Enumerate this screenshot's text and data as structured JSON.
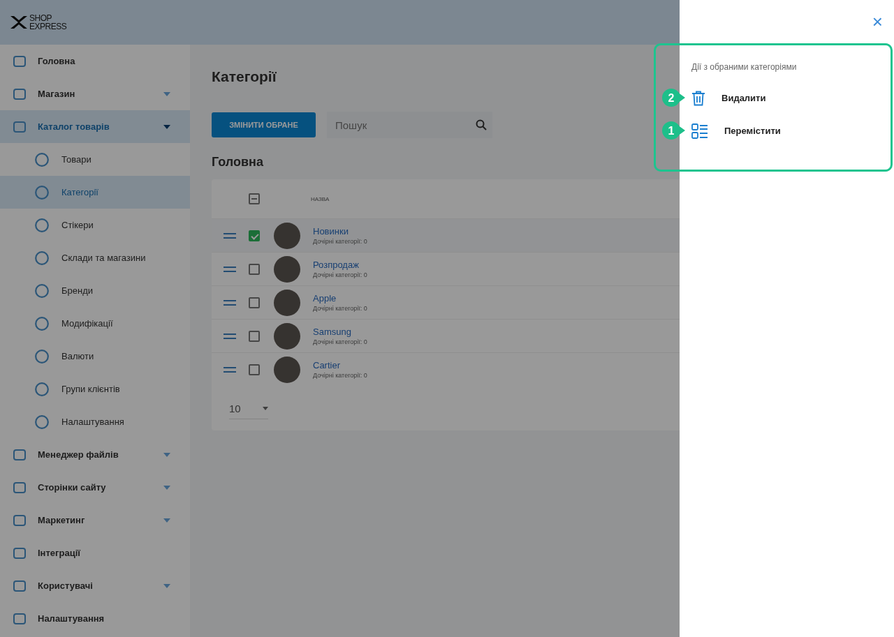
{
  "logo": {
    "line_1": "SHOP",
    "line_2": "EXPRESS"
  },
  "sidebar": {
    "items": [
      {
        "label": "Головна",
        "selected": false
      },
      {
        "label": "Магазин",
        "selected": false,
        "expanded": false
      },
      {
        "label": "Каталог товарів",
        "selected": true,
        "expanded": true,
        "children": [
          {
            "label": "Товари",
            "selected": false
          },
          {
            "label": "Категорії",
            "selected": true
          },
          {
            "label": "Стікери",
            "selected": false
          },
          {
            "label": "Склади та магазини",
            "selected": false
          },
          {
            "label": "Бренди",
            "selected": false
          },
          {
            "label": "Модифікації",
            "selected": false
          },
          {
            "label": "Валюти",
            "selected": false
          },
          {
            "label": "Групи клієнтів",
            "selected": false
          },
          {
            "label": "Налаштування",
            "selected": false
          }
        ]
      },
      {
        "label": "Менеджер файлів",
        "selected": false,
        "expanded": false
      },
      {
        "label": "Сторінки сайту",
        "selected": false,
        "expanded": false
      },
      {
        "label": "Маркетинг",
        "selected": false,
        "expanded": false
      },
      {
        "label": "Інтеграції",
        "selected": false
      },
      {
        "label": "Користувачі",
        "selected": false,
        "expanded": false
      },
      {
        "label": "Налаштування",
        "selected": false
      }
    ]
  },
  "page": {
    "title": "Категорії",
    "edit_button": "ЗМІНИТИ ОБРАНЕ",
    "search": {
      "placeholder": "Пошук"
    },
    "section_title": "Головна"
  },
  "table": {
    "select_all": {
      "indeterminate": true
    },
    "columns": [
      "НАЗВА"
    ],
    "rows": [
      {
        "name": "Новинки",
        "subtitle": "Дочірні категорії: 0",
        "checked": true
      },
      {
        "name": "Розпродаж",
        "subtitle": "Дочірні категорії: 0",
        "checked": false
      },
      {
        "name": "Apple",
        "subtitle": "Дочірні категорії: 0",
        "checked": false
      },
      {
        "name": "Samsung",
        "subtitle": "Дочірні категорії: 0",
        "checked": false
      },
      {
        "name": "Cartier",
        "subtitle": "Дочірні категорії: 0",
        "checked": false
      }
    ],
    "page_size": "10"
  },
  "drawer": {
    "close": "×",
    "heading": "Дії з обраними категоріями",
    "actions": [
      {
        "kind": "delete",
        "label": "Видалити",
        "badge": "2"
      },
      {
        "kind": "move",
        "label": "Перемістити",
        "badge": "1"
      }
    ]
  }
}
